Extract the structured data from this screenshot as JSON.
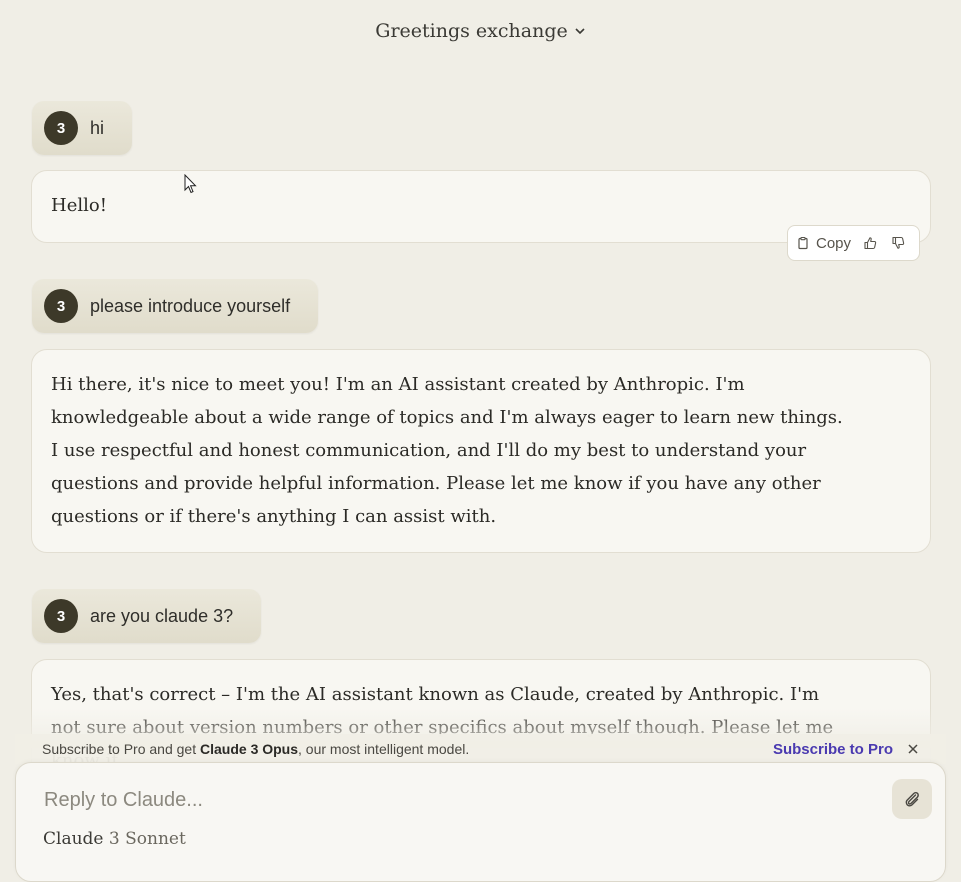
{
  "header": {
    "title": "Greetings exchange"
  },
  "user_avatar_initial": "3",
  "messages": [
    {
      "role": "user",
      "text": "hi"
    },
    {
      "role": "assistant",
      "text": "Hello!"
    },
    {
      "role": "user",
      "text": "please introduce yourself"
    },
    {
      "role": "assistant",
      "text": "Hi there, it's nice to meet you! I'm an AI assistant created by Anthropic. I'm knowledgeable about a wide range of topics and I'm always eager to learn new things. I use respectful and honest communication, and I'll do my best to understand your questions and provide helpful information. Please let me know if you have any other questions or if there's anything I can assist with."
    },
    {
      "role": "user",
      "text": "are you claude 3?"
    },
    {
      "role": "assistant",
      "text": "Yes, that's correct – I'm the AI assistant known as Claude, created by Anthropic. I'm not sure about version numbers or other specifics about myself though. Please let me know if"
    }
  ],
  "actions": {
    "copy_label": "Copy"
  },
  "promo": {
    "prefix": "Subscribe to Pro and get ",
    "model_name": "Claude 3 Opus",
    "suffix": ", our most intelligent model.",
    "link_label": "Subscribe to Pro"
  },
  "composer": {
    "placeholder": "Reply to Claude...",
    "model_brand": "Claude",
    "model_version": " 3 Sonnet"
  },
  "colors": {
    "accent_link": "#4a3ab0",
    "avatar_bg": "#3d3929",
    "background": "#f0eee6"
  },
  "icons": [
    "chevron-down-icon",
    "clipboard-icon",
    "thumbs-up-icon",
    "thumbs-down-icon",
    "close-icon",
    "paperclip-icon",
    "mouse-cursor-icon"
  ]
}
